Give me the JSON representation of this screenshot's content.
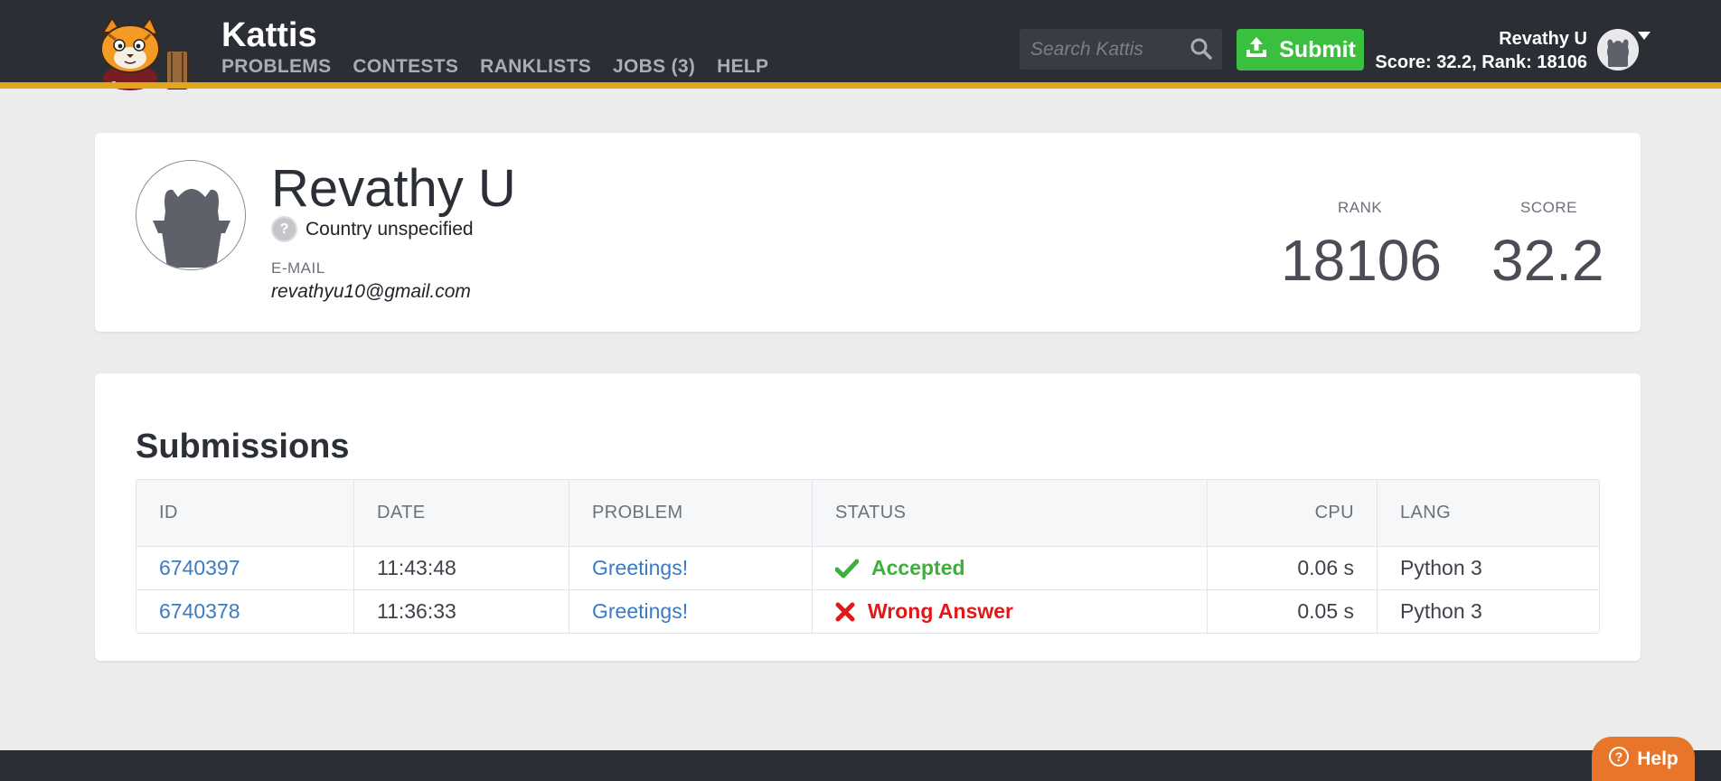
{
  "header": {
    "brand": "Kattis",
    "nav": [
      "PROBLEMS",
      "CONTESTS",
      "RANKLISTS",
      "JOBS (3)",
      "HELP"
    ],
    "search_placeholder": "Search Kattis",
    "submit_label": "Submit",
    "user_name": "Revathy U",
    "user_stats": "Score: 32.2, Rank: 18106"
  },
  "profile": {
    "name": "Revathy U",
    "country": "Country unspecified",
    "email_label": "E-MAIL",
    "email": "revathyu10@gmail.com",
    "rank_label": "RANK",
    "rank": "18106",
    "score_label": "SCORE",
    "score": "32.2"
  },
  "submissions": {
    "title": "Submissions",
    "columns": [
      "ID",
      "DATE",
      "PROBLEM",
      "STATUS",
      "CPU",
      "LANG"
    ],
    "rows": [
      {
        "id": "6740397",
        "date": "11:43:48",
        "problem": "Greetings!",
        "status": "Accepted",
        "cpu": "0.06 s",
        "lang": "Python 3"
      },
      {
        "id": "6740378",
        "date": "11:36:33",
        "problem": "Greetings!",
        "status": "Wrong Answer",
        "cpu": "0.05 s",
        "lang": "Python 3"
      }
    ]
  },
  "help_label": "Help",
  "colors": {
    "topbar": "#2c2e36",
    "accent_stripe": "#e3a51a",
    "submit_green": "#3bbf3f",
    "accepted": "#3bb13b",
    "wrong": "#e01818",
    "link": "#3b7bc4",
    "help_orange": "#e8762a"
  },
  "icons": [
    "kattis-cat-logo",
    "search-icon",
    "upload-icon",
    "user-avatar",
    "caret-down-icon",
    "question-icon",
    "check-icon",
    "cross-icon",
    "help-icon"
  ]
}
